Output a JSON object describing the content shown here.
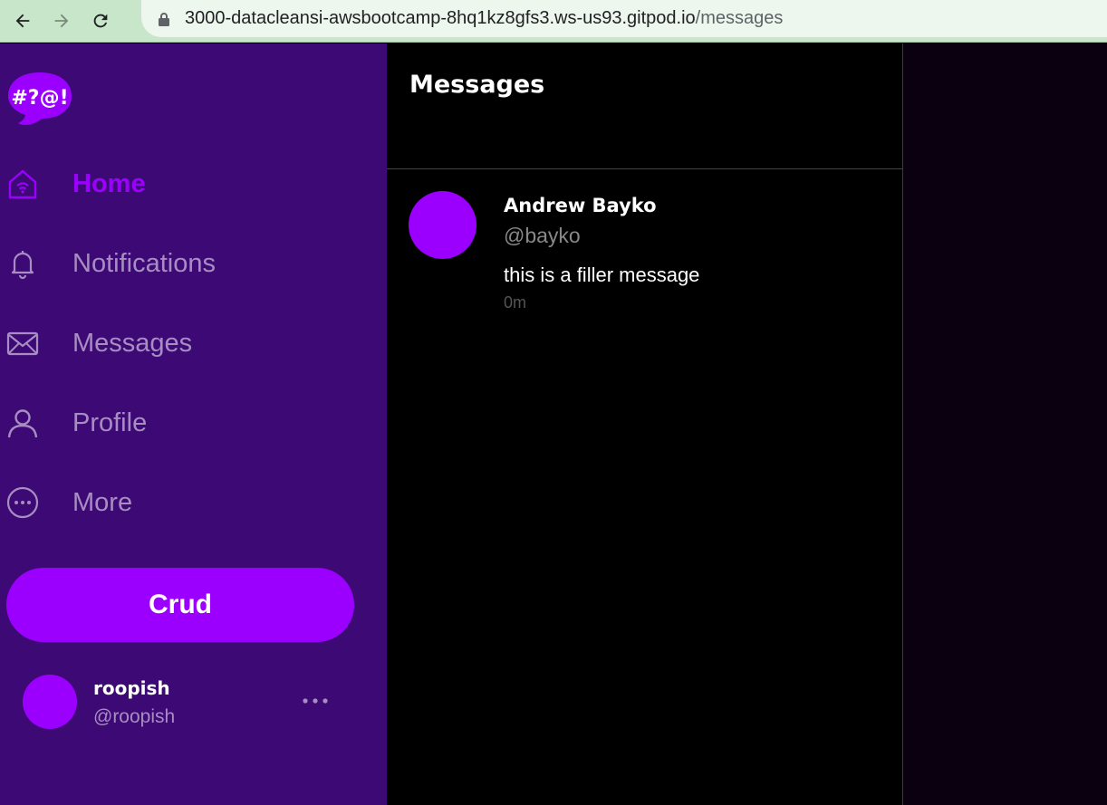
{
  "browser": {
    "url_host": "3000-datacleansi-awsbootcamp-8hq1kz8gfs3.ws-us93.gitpod.io",
    "url_path": "/messages"
  },
  "logo": {
    "text": "#?@!"
  },
  "sidebar": {
    "items": [
      {
        "label": "Home",
        "icon": "home-icon"
      },
      {
        "label": "Notifications",
        "icon": "bell-icon"
      },
      {
        "label": "Messages",
        "icon": "envelope-icon"
      },
      {
        "label": "Profile",
        "icon": "person-icon"
      },
      {
        "label": "More",
        "icon": "more-circle-icon"
      }
    ],
    "crud_label": "Crud",
    "user": {
      "name": "roopish",
      "handle": "@roopish"
    }
  },
  "main": {
    "title": "Messages",
    "messages": [
      {
        "name": "Andrew Bayko",
        "handle": "@bayko",
        "text": "this is a filler message",
        "time": "0m"
      }
    ]
  },
  "colors": {
    "accent": "#9b00ff",
    "sidebar_bg": "#3d0a75",
    "nav_inactive": "#a78dc2",
    "main_bg": "#000000"
  }
}
